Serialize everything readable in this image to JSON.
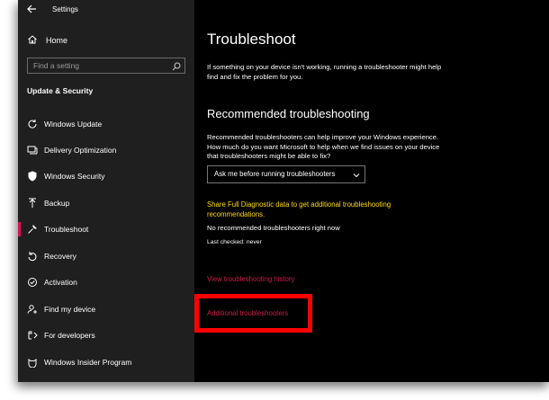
{
  "window": {
    "title": "Settings"
  },
  "sidebar": {
    "home_label": "Home",
    "search_placeholder": "Find a setting",
    "section_title": "Update & Security",
    "items": [
      {
        "label": "Windows Update",
        "icon": "refresh-icon"
      },
      {
        "label": "Delivery Optimization",
        "icon": "delivery-icon"
      },
      {
        "label": "Windows Security",
        "icon": "shield-icon"
      },
      {
        "label": "Backup",
        "icon": "backup-arrow-icon"
      },
      {
        "label": "Troubleshoot",
        "icon": "wrench-icon",
        "selected": true
      },
      {
        "label": "Recovery",
        "icon": "recovery-icon"
      },
      {
        "label": "Activation",
        "icon": "check-circle-icon"
      },
      {
        "label": "Find my device",
        "icon": "person-locate-icon"
      },
      {
        "label": "For developers",
        "icon": "developer-icon"
      },
      {
        "label": "Windows Insider Program",
        "icon": "insider-cat-icon"
      }
    ]
  },
  "main": {
    "title": "Troubleshoot",
    "intro": "If something on your device isn't working, running a troubleshooter might help find and fix the problem for you.",
    "recommended_heading": "Recommended troubleshooting",
    "recommended_text": "Recommended troubleshooters can help improve your Windows experience. How much do you want Microsoft to help when we find issues on your device that troubleshooters might be able to fix?",
    "dropdown_value": "Ask me before running troubleshooters",
    "share_link": "Share Full Diagnostic data to get additional troubleshooting recommendations.",
    "no_recommended": "No recommended troubleshooters right now",
    "last_checked": "Last checked: never",
    "history_link": "View troubleshooting history",
    "additional_link": "Additional troubleshooters"
  },
  "colors": {
    "accent": "#e0105a",
    "link_red": "#d11a4a",
    "link_yellow": "#ffd90f",
    "highlight": "#ff0000"
  }
}
